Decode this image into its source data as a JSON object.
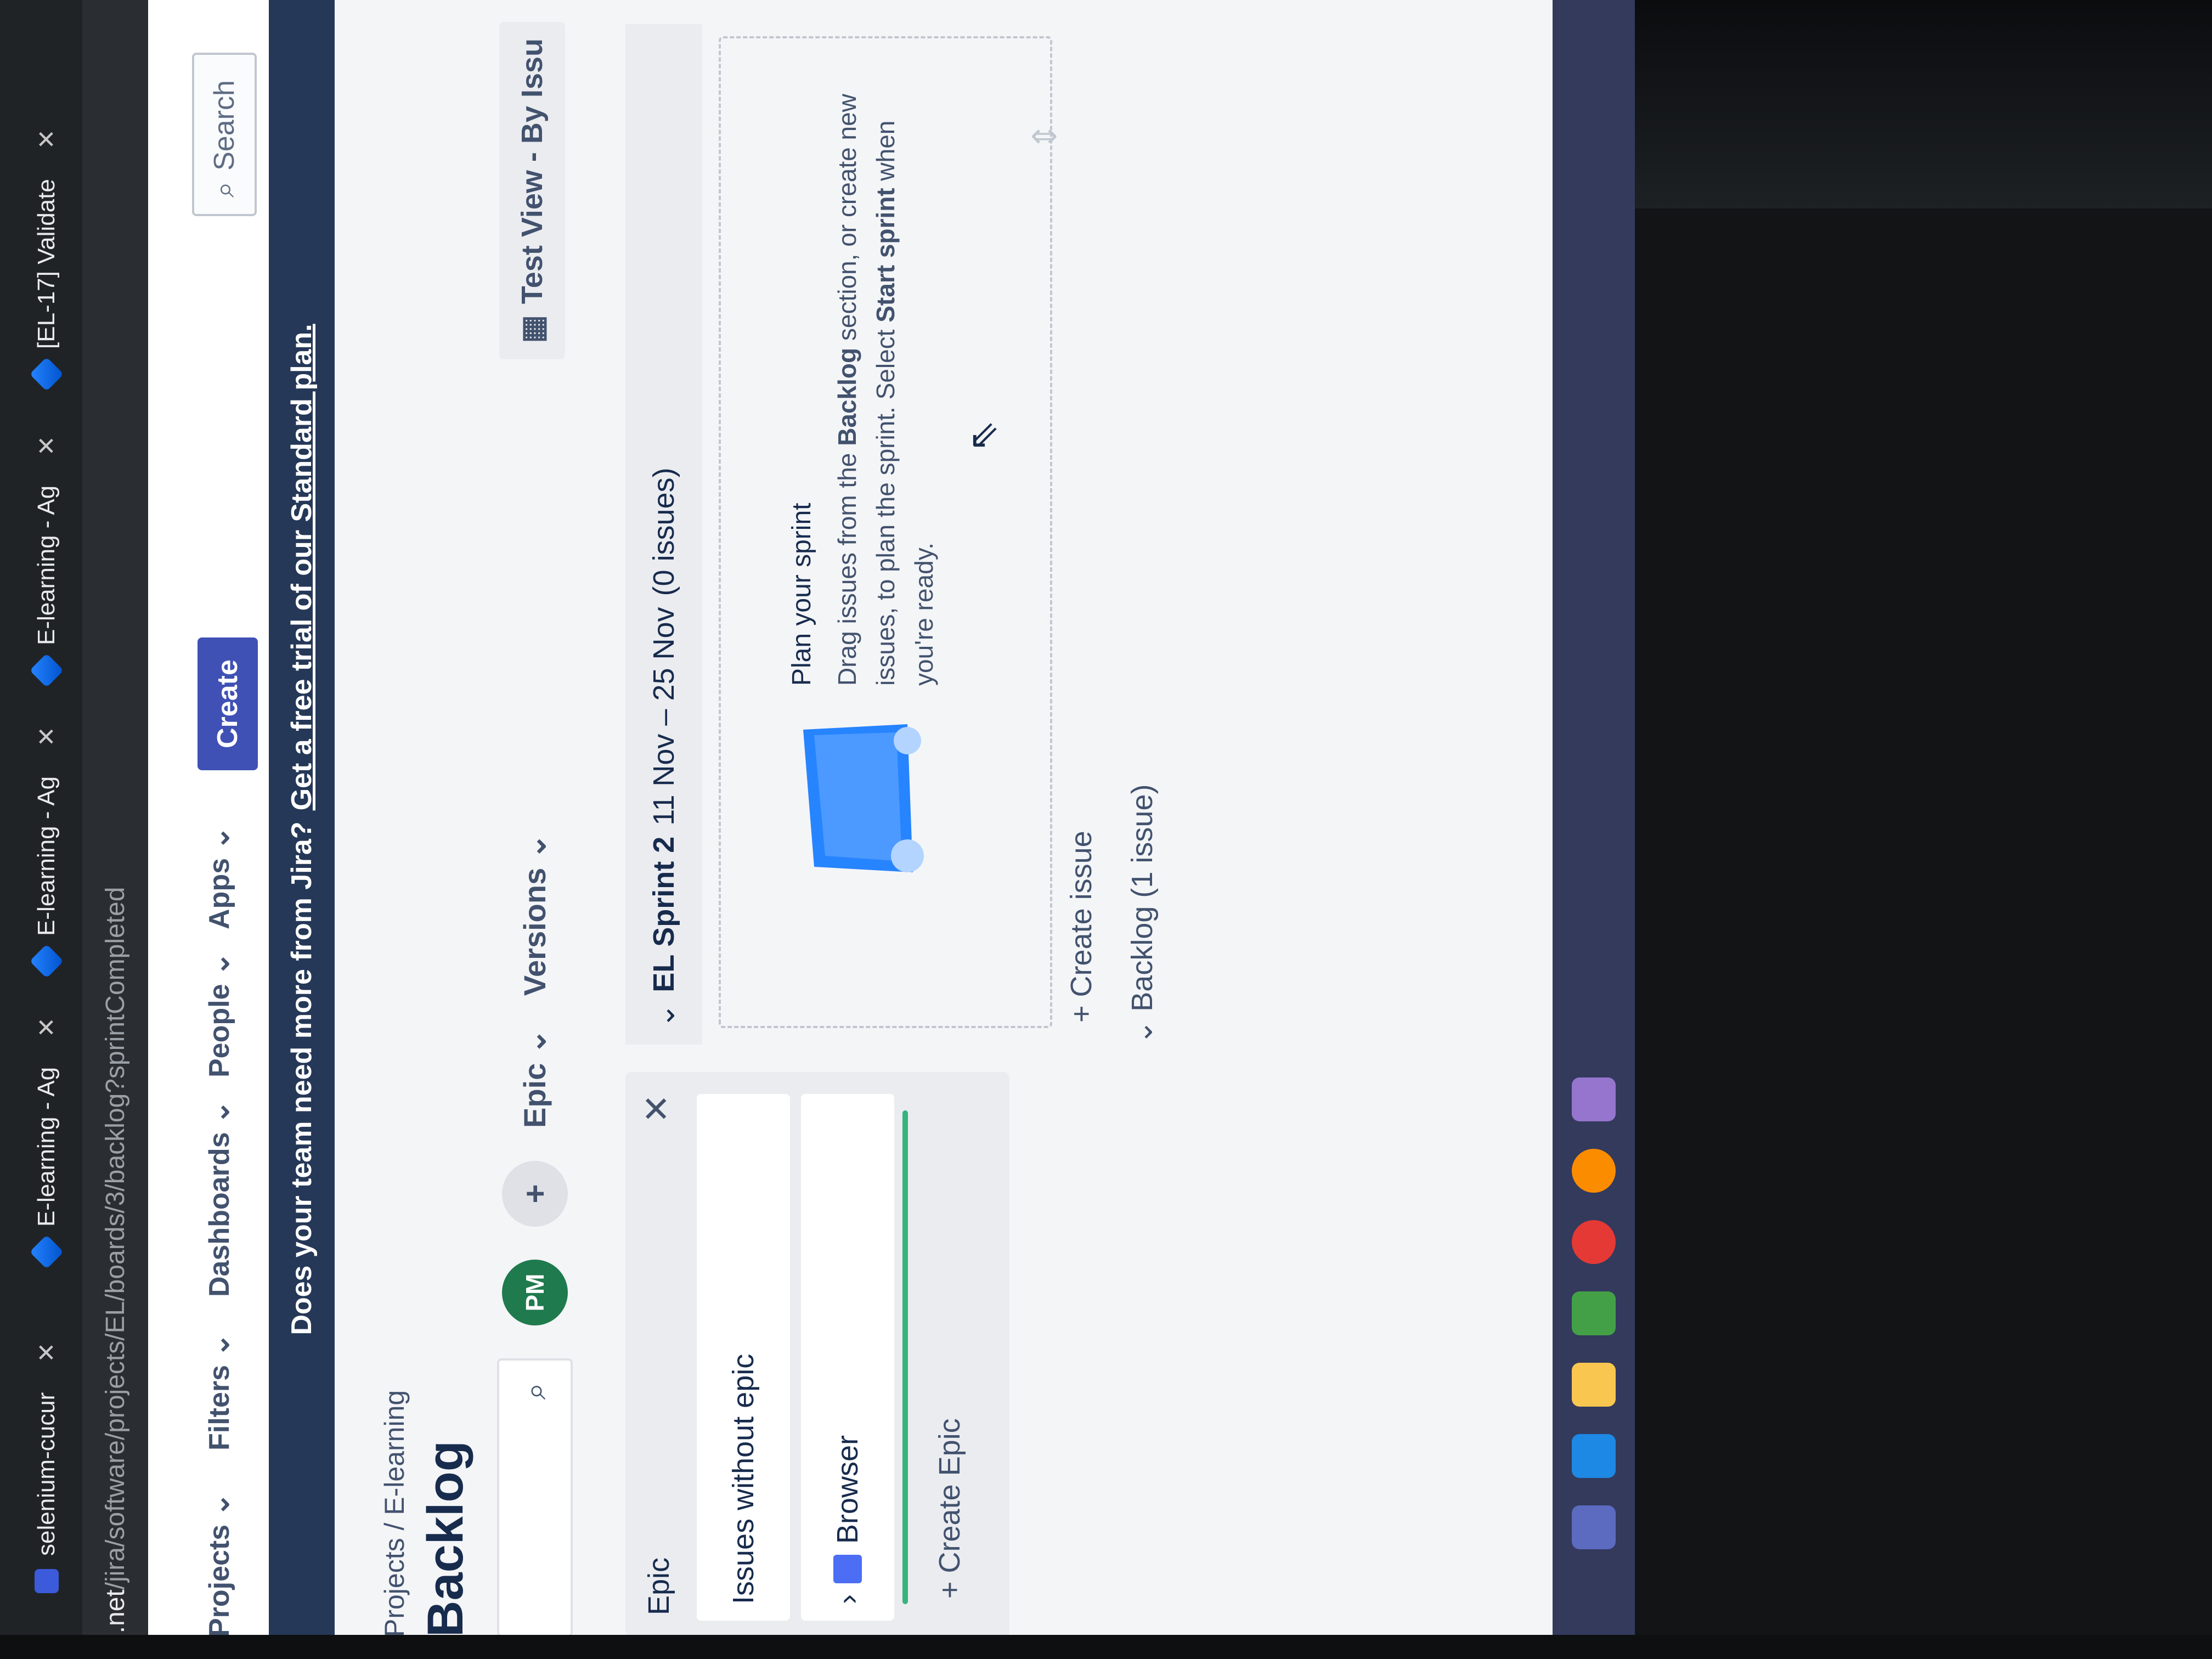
{
  "browser": {
    "tabs": [
      {
        "label": "selenium-cucur"
      },
      {
        "label": "E-learning - Ag"
      },
      {
        "label": "E-learning - Ag"
      },
      {
        "label": "E-learning - Ag"
      },
      {
        "label": "[EL-17] Validate"
      }
    ],
    "address": {
      "host": "n.net",
      "path": "/jira/software/projects/EL/boards/3/backlog?sprintCompleted"
    }
  },
  "nav": {
    "projects": "Projects",
    "filters": "Filters",
    "dashboards": "Dashboards",
    "people": "People",
    "apps": "Apps",
    "create": "Create",
    "search": "Search"
  },
  "banner": {
    "text": "Does your team need more from Jira?",
    "link": "Get a free trial of our Standard plan."
  },
  "breadcrumb": "Projects  /  E-learning",
  "page_title": "Backlog",
  "filters": {
    "avatar_initials": "PM",
    "epic": "Epic",
    "versions": "Versions"
  },
  "test_view": "Test View - By Issu",
  "epic_panel": {
    "heading": "Epic",
    "rows": [
      "Issues without epic",
      "Browser"
    ],
    "create_epic": "Create Epic"
  },
  "sprint": {
    "name": "EL Sprint 2",
    "dates": "11 Nov – 25 Nov",
    "count": "(0 issues)",
    "plan_title": "Plan your sprint",
    "plan_text_1": "Drag issues from the",
    "plan_text_backlog": "Backlog",
    "plan_text_2": "section, or create new issues, to plan the sprint. Select",
    "plan_text_start": "Start sprint",
    "plan_text_3": "when you're ready.",
    "create_issue": "Create issue"
  },
  "backlog": {
    "label": "Backlog",
    "count": "(1 issue)"
  },
  "colors": {
    "primary": "#3f51b5",
    "banner": "#253858",
    "epic_progress": "#36b37e",
    "avatar_pm": "#1f7a4d"
  }
}
